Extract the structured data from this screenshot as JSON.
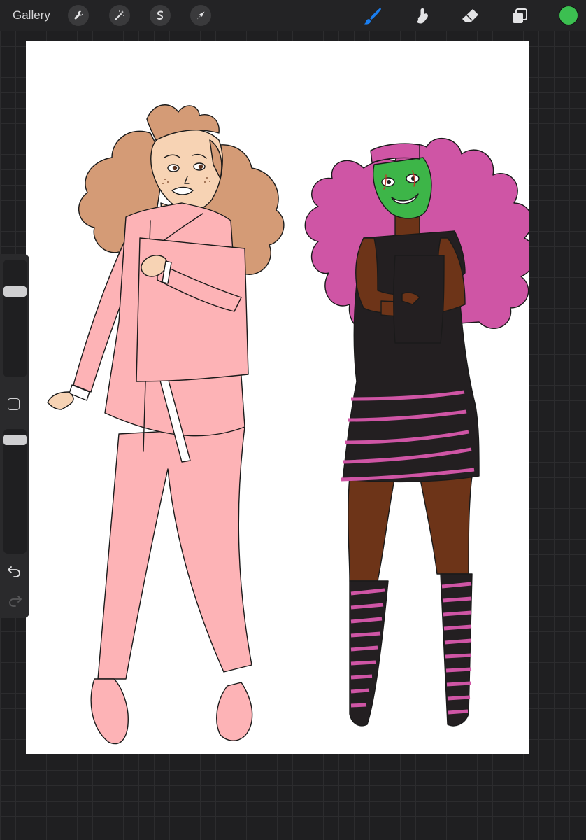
{
  "toolbar": {
    "gallery_label": "Gallery",
    "left_tools": [
      "wrench-icon",
      "magic-wand-icon",
      "selection-icon",
      "transform-arrow-icon"
    ],
    "right_tools": [
      "brush-icon",
      "smudge-icon",
      "eraser-icon",
      "layers-icon"
    ],
    "active_tool": "brush",
    "active_color": "#3cbf51",
    "brush_accent": "#1a7ef0"
  },
  "sidebar": {
    "brush_size_level": 0.75,
    "brush_opacity_level": 0.95,
    "controls": [
      "size-slider",
      "modify-button",
      "opacity-slider",
      "undo-icon",
      "redo-icon"
    ]
  },
  "canvas": {
    "background": "#ffffff",
    "palette": {
      "pink_outfit": "#fdb3b6",
      "hair_light": "#d49b76",
      "skin_light": "#f7d3b4",
      "hair_magenta": "#cf55a5",
      "mask_green": "#3db548",
      "skin_dark": "#6d3418",
      "dress_black": "#231f21",
      "stripe_pink": "#cf55a5"
    }
  }
}
